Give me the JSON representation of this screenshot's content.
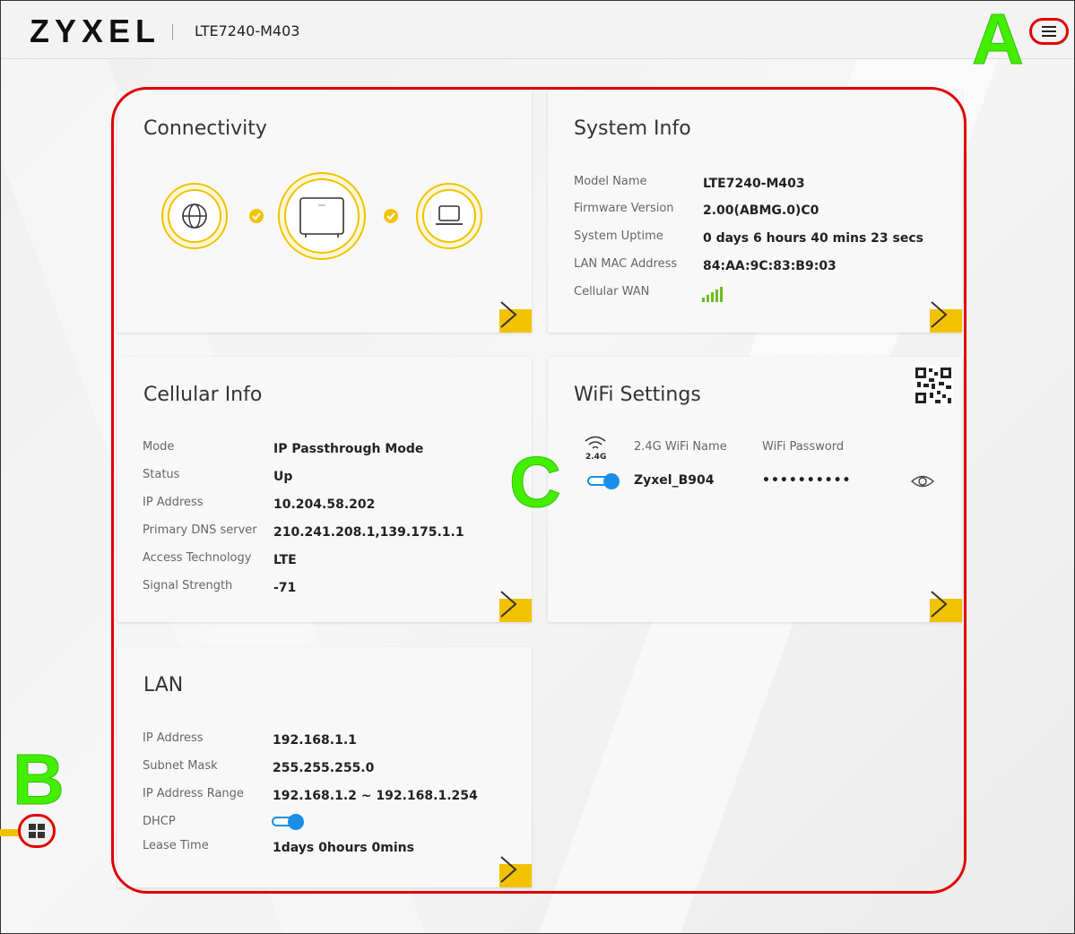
{
  "header": {
    "brand": "ZYXEL",
    "model": "LTE7240-M403",
    "menu_icon": "hamburger-icon"
  },
  "annotations": {
    "a": "A",
    "b": "B",
    "c": "C"
  },
  "colors": {
    "accent": "#f2c200",
    "toggle": "#1a8ee6",
    "annotation": "#44ee00",
    "outline": "#e00000",
    "signal": "#6cbf1f"
  },
  "connectivity": {
    "title": "Connectivity",
    "icons": [
      "globe-icon",
      "router-icon",
      "laptop-icon"
    ]
  },
  "system_info": {
    "title": "System Info",
    "rows": [
      {
        "label": "Model Name",
        "value": "LTE7240-M403"
      },
      {
        "label": "Firmware Version",
        "value": "2.00(ABMG.0)C0"
      },
      {
        "label": "System Uptime",
        "value": "0 days 6 hours 40 mins 23 secs"
      },
      {
        "label": "LAN MAC Address",
        "value": "84:AA:9C:83:B9:03"
      },
      {
        "label": "Cellular WAN",
        "value": ""
      }
    ],
    "signal_bars": 5
  },
  "cellular_info": {
    "title": "Cellular Info",
    "rows": [
      {
        "label": "Mode",
        "value": "IP Passthrough Mode"
      },
      {
        "label": "Status",
        "value": "Up"
      },
      {
        "label": "IP Address",
        "value": "10.204.58.202"
      },
      {
        "label": "Primary DNS server",
        "value": "210.241.208.1,139.175.1.1"
      },
      {
        "label": "Access Technology",
        "value": "LTE"
      },
      {
        "label": "Signal Strength",
        "value": "-71"
      }
    ]
  },
  "wifi": {
    "title": "WiFi Settings",
    "band": "2.4G",
    "name_header": "2.4G WiFi Name",
    "password_header": "WiFi Password",
    "ssid": "Zyxel_B904",
    "password_masked": "••••••••••",
    "enabled": true
  },
  "lan": {
    "title": "LAN",
    "rows": [
      {
        "label": "IP Address",
        "value": "192.168.1.1"
      },
      {
        "label": "Subnet Mask",
        "value": "255.255.255.0"
      },
      {
        "label": "IP Address Range",
        "value": "192.168.1.2 ~ 192.168.1.254"
      },
      {
        "label": "DHCP",
        "value": ""
      },
      {
        "label": "Lease Time",
        "value": "1days 0hours 0mins"
      }
    ],
    "dhcp_enabled": true
  }
}
